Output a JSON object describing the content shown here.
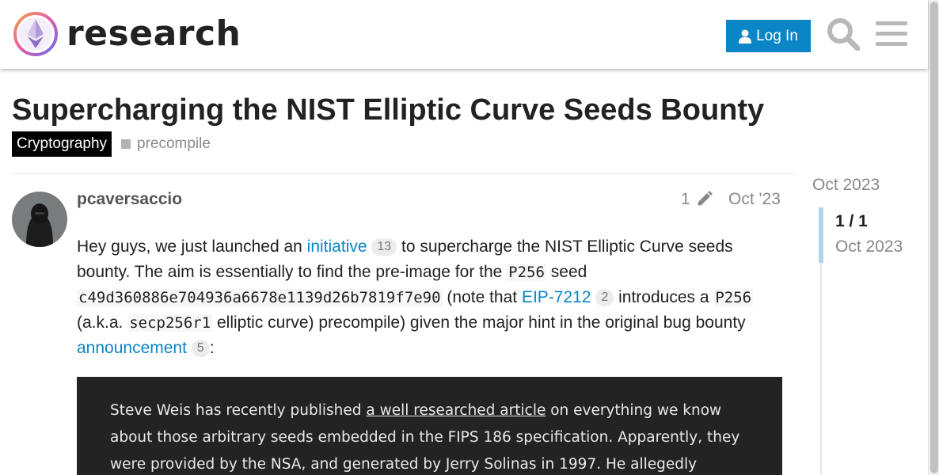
{
  "header": {
    "site_name": "research",
    "login_label": "Log In",
    "icons": [
      "logo-icon",
      "user-icon",
      "search-icon",
      "hamburger-menu-icon"
    ],
    "accent_color": "#0a85c6"
  },
  "topic": {
    "title": "Supercharging the NIST Elliptic Curve Seeds Bounty",
    "category": "Cryptography",
    "tag": "precompile"
  },
  "post": {
    "username": "pcaversaccio",
    "edit_count": "1",
    "date": "Oct '23",
    "body": {
      "p1_t1": "Hey guys, we just launched an ",
      "link1": "initiative",
      "link1_count": "13",
      "p1_t2": " to supercharge the NIST Elliptic Curve seeds bounty. The aim is essentially to find the pre-image for the ",
      "code1": "P256",
      "p1_t3": " seed ",
      "code2": "c49d360886e704936a6678e1139d26b7819f7e90",
      "p1_t4": " (note that ",
      "link2": "EIP-7212",
      "link2_count": "2",
      "p1_t5": " introduces a ",
      "code3": "P256",
      "p1_t6": " (a.k.a. ",
      "code4": "secp256r1",
      "p1_t7": " elliptic curve) precompile) given the major hint in the original bug bounty ",
      "link3": "announcement",
      "link3_count": "5",
      "p1_t8": ":"
    },
    "quote_image": {
      "t1": "Steve Weis has recently published ",
      "link": "a well researched article",
      "t2": " on everything we know about those arbitrary seeds embedded in the FIPS 186 specification. Apparently, they were provided by the NSA, and generated by Jerry Solinas in 1997. He allegedly"
    }
  },
  "timeline": {
    "start_date": "Oct 2023",
    "position": "1 / 1",
    "current_date": "Oct 2023"
  }
}
